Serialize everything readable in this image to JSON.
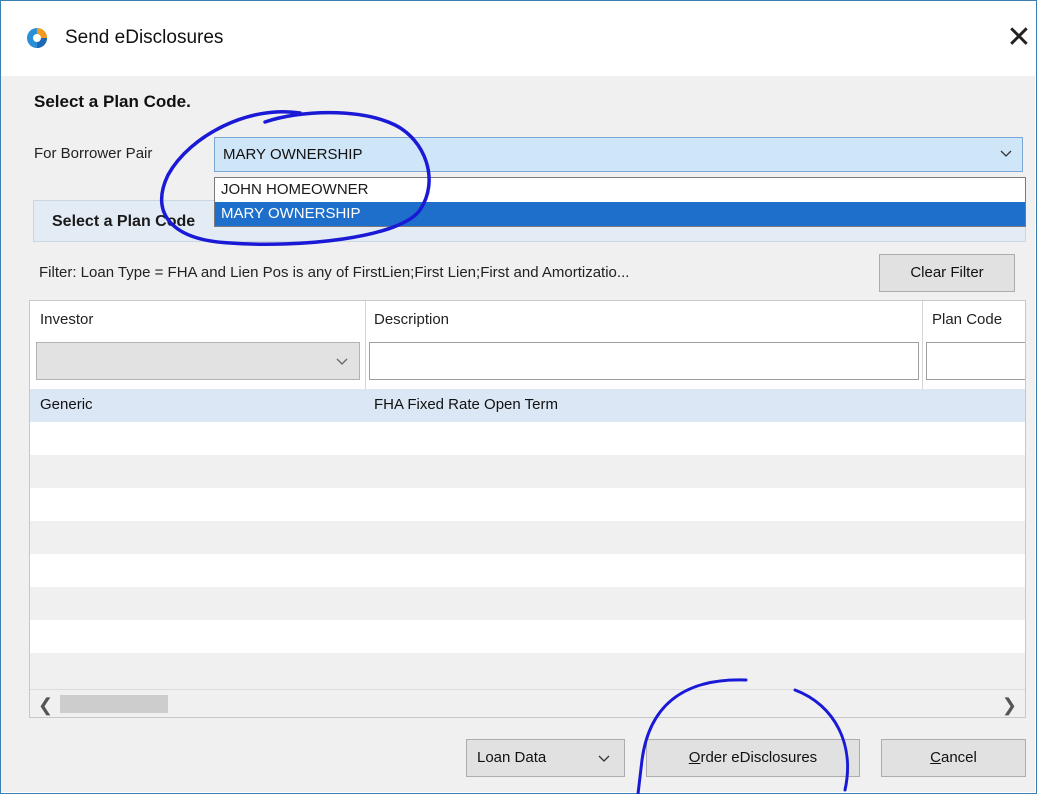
{
  "window": {
    "title": "Send eDisclosures",
    "close_glyph": "✕",
    "icon": "app-logo-icon"
  },
  "heading": "Select a Plan Code.",
  "borrower_pair": {
    "label": "For Borrower Pair",
    "value": "MARY OWNERSHIP",
    "options": [
      "JOHN HOMEOWNER",
      "MARY OWNERSHIP"
    ],
    "selected_index": 1
  },
  "plan_panel": {
    "title": "Select a Plan Code"
  },
  "filter": {
    "text": "Filter: Loan Type = FHA  and  Lien Pos is any of FirstLien;First Lien;First  and  Amortizatio...",
    "clear_label": "Clear Filter"
  },
  "grid": {
    "columns": [
      "Investor",
      "Description",
      "Plan Code"
    ],
    "rows": [
      {
        "investor": "Generic",
        "description": "FHA Fixed Rate Open Term",
        "plan_code": ""
      }
    ],
    "empty_row_count": 8,
    "selected_row_color": "#dbe7f5"
  },
  "buttons": {
    "loan_data": "Loan Data",
    "order": "Order eDisclosures",
    "cancel": "Cancel"
  },
  "colors": {
    "accent": "#1e6fcb",
    "annotation_ink": "#1a1ad6"
  }
}
